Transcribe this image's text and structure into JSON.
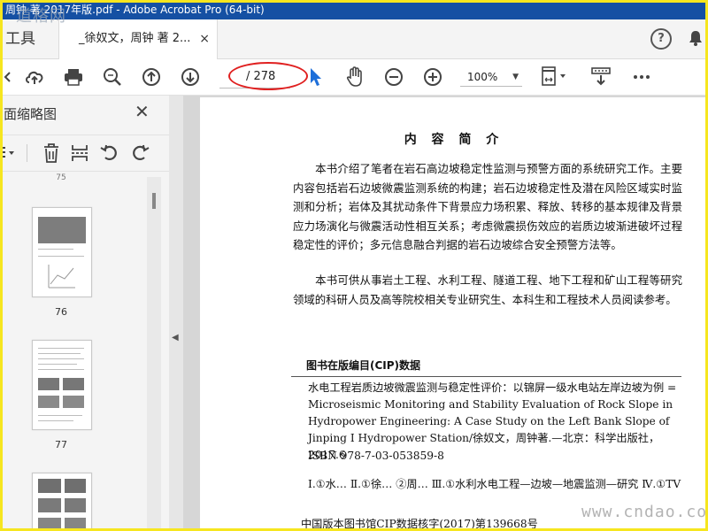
{
  "window": {
    "title": "周钟 著 2017年版.pdf - Adobe Acrobat Pro (64-bit)"
  },
  "watermarks": {
    "top_left": "道格网",
    "bottom_right": "www.cndao.com"
  },
  "tabs": {
    "tools_label": "工具",
    "document_label": "_徐奴文，周钟 著 2...",
    "close_glyph": "×"
  },
  "header_icons": {
    "help": "?",
    "help_icon": "help-circle-icon",
    "bell_icon": "bell-icon"
  },
  "toolbar": {
    "page_current": "",
    "page_total": "/ 278",
    "zoom": "100%",
    "icons": [
      "back-icon",
      "upload-cloud-icon",
      "print-icon",
      "zoom-search-icon",
      "page-up-icon",
      "page-down-icon",
      "select-cursor-icon",
      "hand-tool-icon",
      "zoom-out-icon",
      "zoom-in-icon",
      "page-fit-icon",
      "scroll-mode-icon",
      "more-icon"
    ]
  },
  "panel": {
    "title": "面缩略图",
    "close_glyph": "✕",
    "tools": [
      "options-dropdown-icon",
      "delete-icon",
      "insert-page-icon",
      "rotate-left-icon",
      "rotate-right-icon"
    ],
    "thumbnails": [
      {
        "label": "75"
      },
      {
        "label": "76"
      },
      {
        "label": "77"
      },
      {
        "label": ""
      }
    ]
  },
  "page": {
    "heading": "内 容 简 介",
    "para1": "本书介绍了笔者在岩石高边坡稳定性监测与预警方面的系统研究工作。主要内容包括岩石边坡微震监测系统的构建；岩石边坡稳定性及潜在风险区域实时监测和分析；岩体及其扰动条件下背景应力场积累、释放、转移的基本规律及背景应力场演化与微震活动性相互关系；考虑微震损伤效应的岩质边坡渐进破坏过程稳定性的评价；多元信息融合判据的岩石边坡综合安全预警方法等。",
    "para2": "本书可供从事岩土工程、水利工程、隧道工程、地下工程和矿山工程等研究领域的科研人员及高等院校相关专业研究生、本科生和工程技术人员阅读参考。",
    "cip_heading": "图书在版编目(CIP)数据",
    "cip_text": "水电工程岩质边坡微震监测与稳定性评价：以锦屏一级水电站左岸边坡为例 = Microseismic Monitoring and Stability Evaluation of Rock Slope in Hydropower Engineering: A Case Study on the Left Bank Slope of Jinping I Hydropower Station/徐奴文，周钟著.—北京：科学出版社，2017.6",
    "isbn": "ISBN 978-7-03-053859-8",
    "subjects": "Ⅰ.①水…   Ⅱ.①徐…   ②周…   Ⅲ.①水利水电工程—边坡—地震监测—研究   Ⅳ.①TV",
    "cip_number": "中国版本图书馆CIP数据核字(2017)第139668号"
  },
  "colors": {
    "title_bar": "#1550a3",
    "frame": "#f6e61f",
    "annotation_red": "#e02020",
    "select_arrow": "#1e6fd9"
  }
}
